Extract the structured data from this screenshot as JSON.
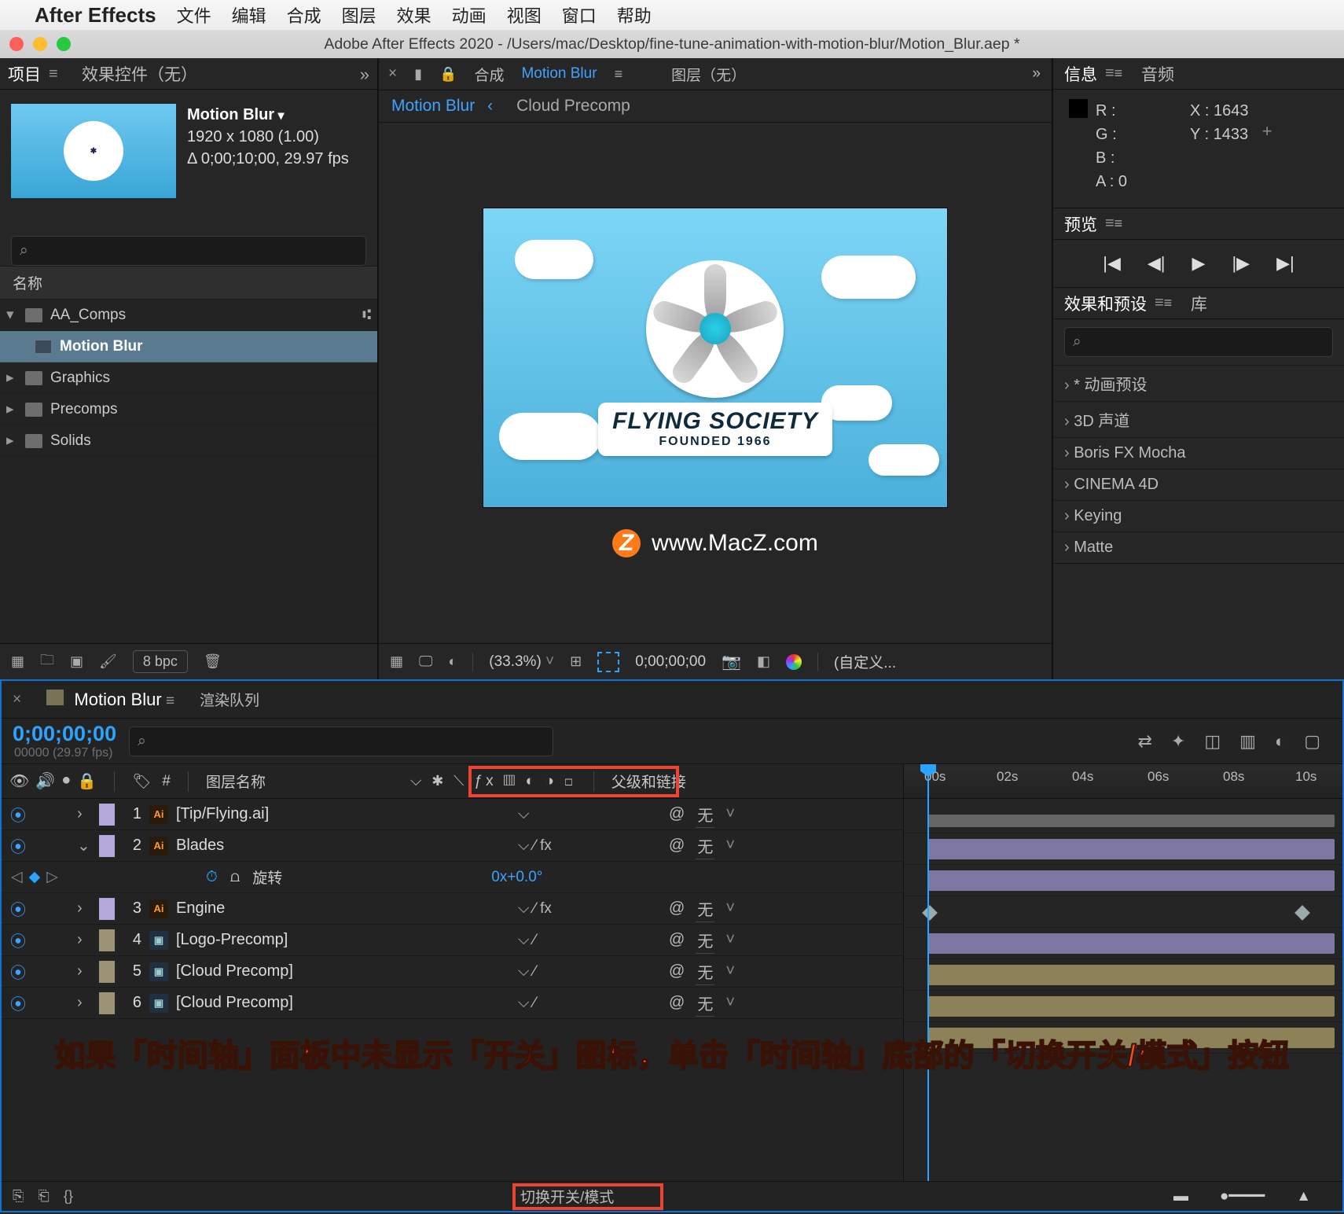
{
  "mac_menu": {
    "app": "After Effects",
    "items": [
      "文件",
      "编辑",
      "合成",
      "图层",
      "效果",
      "动画",
      "视图",
      "窗口",
      "帮助"
    ]
  },
  "window_title": "Adobe After Effects 2020 - /Users/mac/Desktop/fine-tune-animation-with-motion-blur/Motion_Blur.aep *",
  "project_panel": {
    "tab_project": "项目",
    "tab_effects": "效果控件（无）",
    "comp_name": "Motion Blur",
    "comp_dims": "1920 x 1080 (1.00)",
    "comp_dur": "Δ 0;00;10;00, 29.97 fps",
    "search_placeholder": "⌕",
    "col_name": "名称",
    "tree": [
      {
        "type": "folder",
        "open": true,
        "name": "AA_Comps"
      },
      {
        "type": "comp",
        "indent": 1,
        "name": "Motion Blur",
        "selected": true
      },
      {
        "type": "folder",
        "open": false,
        "name": "Graphics"
      },
      {
        "type": "folder",
        "open": false,
        "name": "Precomps"
      },
      {
        "type": "folder",
        "open": false,
        "name": "Solids"
      }
    ],
    "bpc": "8 bpc"
  },
  "comp_viewer": {
    "tab_comp_label": "合成",
    "tab_comp_name": "Motion Blur",
    "tab_layer": "图层（无）",
    "subtab_active": "Motion Blur",
    "subtab_other": "Cloud Precomp",
    "logo_line1": "FLYING SOCIETY",
    "logo_line2": "FOUNDED 1966",
    "watermark": "www.MacZ.com",
    "footer": {
      "zoom": "(33.3%)",
      "time": "0;00;00;00",
      "custom": "(自定义..."
    }
  },
  "info_panel": {
    "tab_info": "信息",
    "tab_audio": "音频",
    "R": "R :",
    "G": "G :",
    "B": "B :",
    "A": "A :  0",
    "X": "X : 1643",
    "Y": "Y : 1433"
  },
  "preview_panel": {
    "tab": "预览"
  },
  "effects_panel": {
    "tab_effects": "效果和预设",
    "tab_lib": "库",
    "search": "⌕",
    "cats": [
      "* 动画预设",
      "3D 声道",
      "Boris FX Mocha",
      "CINEMA 4D",
      "Keying",
      "Matte"
    ]
  },
  "timeline": {
    "tab_name": "Motion Blur",
    "tab_render": "渲染队列",
    "timecode": "0;00;00;00",
    "timecode_sub": "00000 (29.97 fps)",
    "search": "⌕",
    "ruler": [
      "00s",
      "02s",
      "04s",
      "06s",
      "08s",
      "10s"
    ],
    "col_num": "#",
    "col_layer": "图层名称",
    "col_parent": "父级和链接",
    "layers": [
      {
        "n": 1,
        "src": "ai",
        "name": "[Tip/Flying.ai]",
        "sw": "⌵",
        "fx": "",
        "parent": "无",
        "color": "#b4a8db",
        "bar": "purple",
        "open": ">"
      },
      {
        "n": 2,
        "src": "ai",
        "name": "Blades",
        "sw": "⌵  ⁄  fx",
        "parent": "无",
        "color": "#b4a8db",
        "bar": "purple",
        "open": "v"
      },
      {
        "prop": true,
        "label": "旋转",
        "value": "0x+0.0°"
      },
      {
        "n": 3,
        "src": "ai",
        "name": "Engine",
        "sw": "⌵  ⁄  fx",
        "parent": "无",
        "color": "#b4a8db",
        "bar": "purple",
        "open": ">"
      },
      {
        "n": 4,
        "src": "pc",
        "name": "[Logo-Precomp]",
        "sw": "⌵  ⁄",
        "parent": "无",
        "color": "#9c9276",
        "bar": "tan",
        "open": ">"
      },
      {
        "n": 5,
        "src": "pc",
        "name": "[Cloud Precomp]",
        "sw": "⌵  ⁄",
        "parent": "无",
        "color": "#9c9276",
        "bar": "tan",
        "open": ">"
      },
      {
        "n": 6,
        "src": "pc",
        "name": "[Cloud Precomp]",
        "sw": "⌵  ⁄",
        "parent": "无",
        "color": "#9c9276",
        "bar": "tan",
        "open": ">"
      }
    ],
    "toggle_label": "切换开关/模式"
  },
  "annotation": "如果「时间轴」面板中未显示「开关」图标，单击「时间轴」底部的「切换开关/模式」按钮"
}
